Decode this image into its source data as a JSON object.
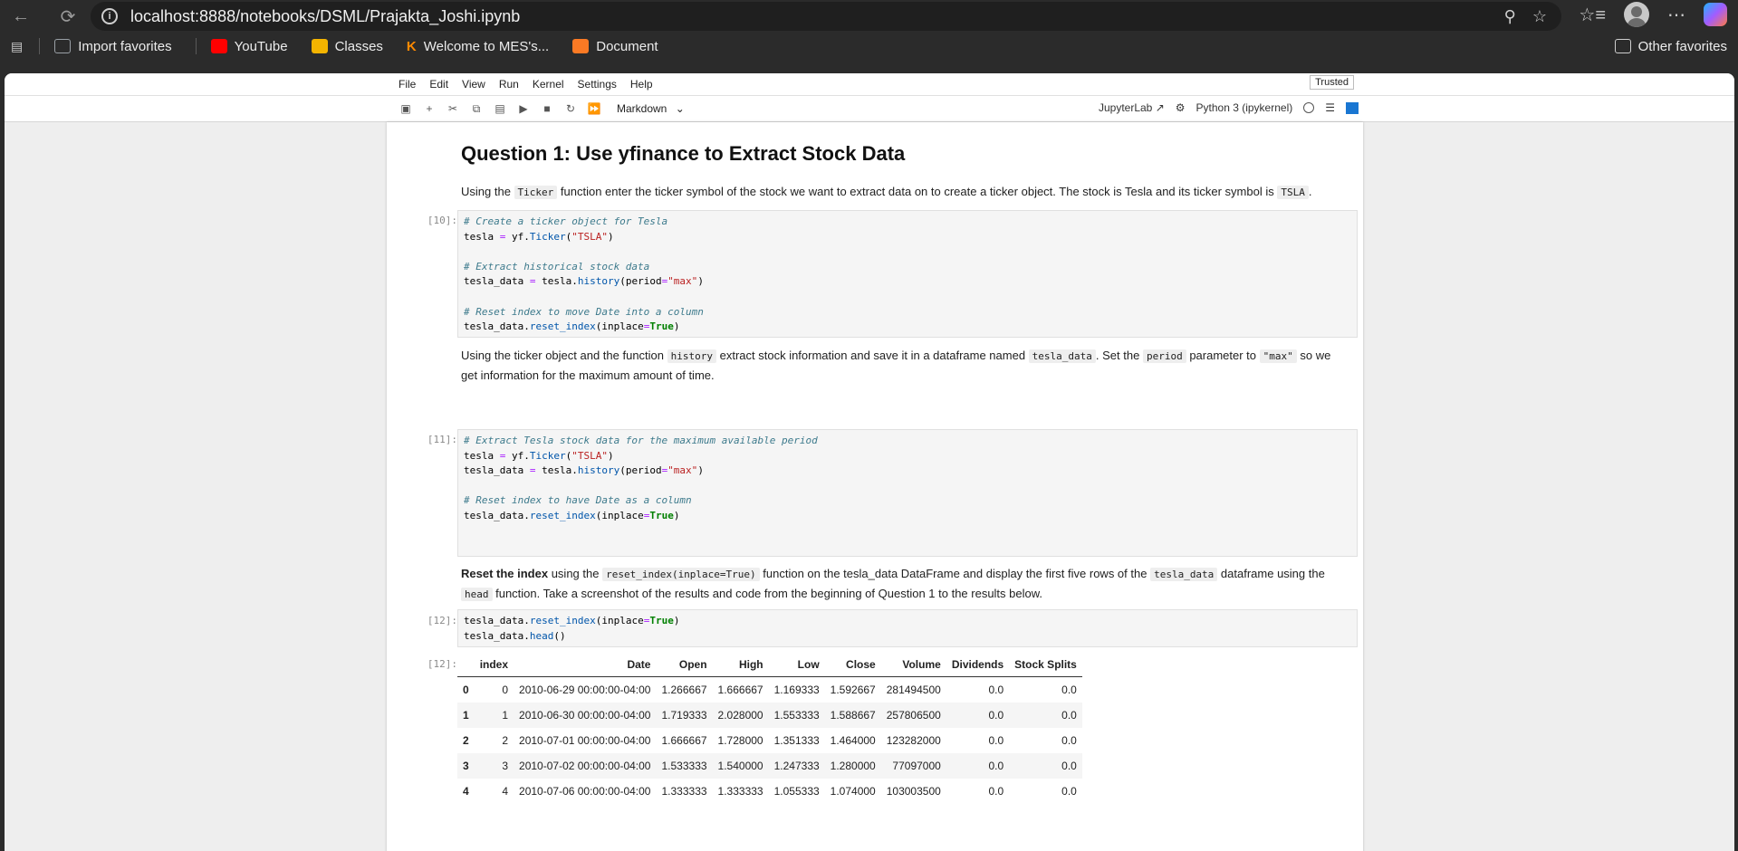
{
  "browser": {
    "url": "localhost:8888/notebooks/DSML/Prajakta_Joshi.ipynb",
    "bookmarks": [
      {
        "label": "Import favorites",
        "icon": "import-icon",
        "color": "#9aa0a6"
      },
      {
        "label": "YouTube",
        "icon": "youtube-icon",
        "color": "#ff0000"
      },
      {
        "label": "Classes",
        "icon": "classroom-icon",
        "color": "#f4b400"
      },
      {
        "label": "Welcome to MES's...",
        "icon": "k-logo-icon",
        "color": "#ff8a00"
      },
      {
        "label": "Document",
        "icon": "xampp-icon",
        "color": "#fb7a24"
      }
    ],
    "other_favorites": "Other favorites"
  },
  "jupyter": {
    "menu": [
      "File",
      "Edit",
      "View",
      "Run",
      "Kernel",
      "Settings",
      "Help"
    ],
    "trusted": "Trusted",
    "cell_type": "Markdown",
    "app_label": "JupyterLab",
    "kernel_label": "Python 3 (ipykernel)"
  },
  "notebook": {
    "heading": "Question 1: Use yfinance to Extract Stock Data",
    "para1": {
      "t1": "Using the ",
      "c1": "Ticker",
      "t2": " function enter the ticker symbol of the stock we want to extract data on to create a ticker object. The stock is Tesla and its ticker symbol is ",
      "c2": "TSLA",
      "t3": "."
    },
    "cell1": {
      "prompt": "[10]:",
      "l1": "# Create a ticker object for Tesla",
      "l2a": "tesla ",
      "l2b": "=",
      "l2c": " yf.",
      "l2d": "Ticker",
      "l2e": "(",
      "l2f": "\"TSLA\"",
      "l2g": ")",
      "l3": "# Extract historical stock data",
      "l4a": "tesla_data ",
      "l4b": "=",
      "l4c": " tesla.",
      "l4d": "history",
      "l4e": "(period",
      "l4f": "=",
      "l4g": "\"max\"",
      "l4h": ")",
      "l5": "# Reset index to move Date into a column",
      "l6a": "tesla_data.",
      "l6b": "reset_index",
      "l6c": "(inplace",
      "l6d": "=",
      "l6e": "True",
      "l6f": ")"
    },
    "para2": {
      "t1": "Using the ticker object and the function ",
      "c1": "history",
      "t2": " extract stock information and save it in a dataframe named ",
      "c2": "tesla_data",
      "t3": ". Set the ",
      "c3": "period",
      "t4": " parameter to ",
      "c4": "\"max\"",
      "t5": " so we",
      "t6": "get information for the maximum amount of time."
    },
    "cell2": {
      "prompt": "[11]:",
      "l1": "# Extract Tesla stock data for the maximum available period",
      "l2a": "tesla ",
      "l2b": "=",
      "l2c": " yf.",
      "l2d": "Ticker",
      "l2e": "(",
      "l2f": "\"TSLA\"",
      "l2g": ")",
      "l3a": "tesla_data ",
      "l3b": "=",
      "l3c": " tesla.",
      "l3d": "history",
      "l3e": "(period",
      "l3f": "=",
      "l3g": "\"max\"",
      "l3h": ")",
      "l4": "# Reset index to have Date as a column",
      "l5a": "tesla_data.",
      "l5b": "reset_index",
      "l5c": "(inplace",
      "l5d": "=",
      "l5e": "True",
      "l5f": ")"
    },
    "para3": {
      "b1": "Reset the index",
      "t1": " using the ",
      "c1": "reset_index(inplace=True)",
      "t2": " function on the tesla_data DataFrame and display the first five rows of the ",
      "c2": "tesla_data",
      "t3": " dataframe using the",
      "c3": "head",
      "t4": " function. Take a screenshot of the results and code from the beginning of Question 1 to the results below."
    },
    "cell3": {
      "prompt": "[12]:",
      "l1a": "tesla_data.",
      "l1b": "reset_index",
      "l1c": "(inplace",
      "l1d": "=",
      "l1e": "True",
      "l1f": ")",
      "l2a": "tesla_data.",
      "l2b": "head",
      "l2c": "()"
    },
    "output": {
      "prompt": "[12]:",
      "columns": [
        "",
        "index",
        "Date",
        "Open",
        "High",
        "Low",
        "Close",
        "Volume",
        "Dividends",
        "Stock Splits"
      ],
      "rows": [
        [
          "0",
          "0",
          "2010-06-29 00:00:00-04:00",
          "1.266667",
          "1.666667",
          "1.169333",
          "1.592667",
          "281494500",
          "0.0",
          "0.0"
        ],
        [
          "1",
          "1",
          "2010-06-30 00:00:00-04:00",
          "1.719333",
          "2.028000",
          "1.553333",
          "1.588667",
          "257806500",
          "0.0",
          "0.0"
        ],
        [
          "2",
          "2",
          "2010-07-01 00:00:00-04:00",
          "1.666667",
          "1.728000",
          "1.351333",
          "1.464000",
          "123282000",
          "0.0",
          "0.0"
        ],
        [
          "3",
          "3",
          "2010-07-02 00:00:00-04:00",
          "1.533333",
          "1.540000",
          "1.247333",
          "1.280000",
          "77097000",
          "0.0",
          "0.0"
        ],
        [
          "4",
          "4",
          "2010-07-06 00:00:00-04:00",
          "1.333333",
          "1.333333",
          "1.055333",
          "1.074000",
          "103003500",
          "0.0",
          "0.0"
        ]
      ]
    }
  }
}
